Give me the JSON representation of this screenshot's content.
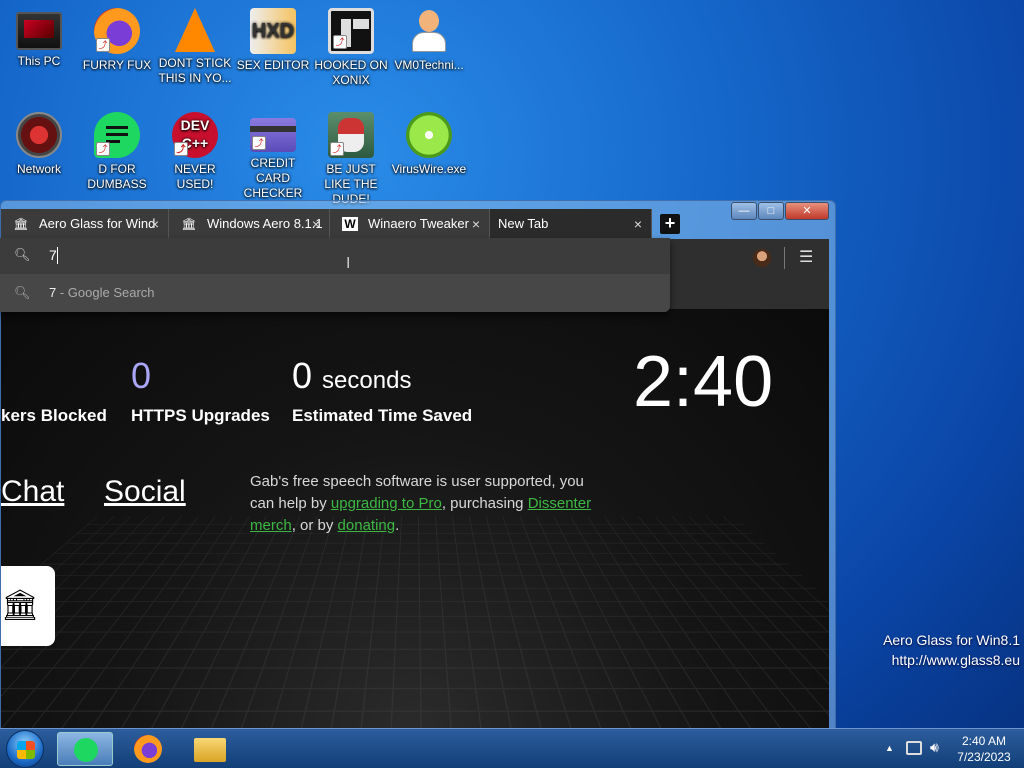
{
  "desktop": {
    "icons": [
      {
        "label": "This PC",
        "icon": "computer-icon"
      },
      {
        "label": "FURRY FUX",
        "icon": "firefox-icon"
      },
      {
        "label": "DONT STICK THIS IN YO...",
        "icon": "vlc-icon"
      },
      {
        "label": "SEX EDITOR",
        "icon": "hex-editor-icon"
      },
      {
        "label": "HOOKED ON XONIX",
        "icon": "xonix-icon"
      },
      {
        "label": "VM0Techni...",
        "icon": "doctor-icon"
      },
      {
        "label": "Network",
        "icon": "network-icon"
      },
      {
        "label": "D FOR DUMBASS",
        "icon": "dumbass-icon"
      },
      {
        "label": "NEVER USED!",
        "icon": "devcpp-icon"
      },
      {
        "label": "CREDIT CARD CHECKER",
        "icon": "credit-card-icon"
      },
      {
        "label": "BE JUST LIKE THE DUDE!",
        "icon": "dude-icon"
      },
      {
        "label": "VirusWire.exe",
        "icon": "limewire-icon"
      }
    ],
    "watermark": {
      "line1": "Aero Glass for Win8.1",
      "line2": "http://www.glass8.eu"
    }
  },
  "browser": {
    "tabs": [
      {
        "label": "Aero Glass for Wind",
        "icon": "institution-icon"
      },
      {
        "label": "Windows Aero 8.1.1",
        "icon": "institution-icon"
      },
      {
        "label": "Winaero Tweaker",
        "icon": "winaero-icon",
        "icon_glyph": "W"
      },
      {
        "label": "New Tab",
        "icon": ""
      }
    ],
    "tab_close": "×",
    "new_tab": "+",
    "window_controls": {
      "minimize": "—",
      "maximize": "□",
      "close": "✕"
    },
    "omnibox": {
      "value": "7",
      "suggestion_query": "7",
      "suggestion_suffix": " - Google Search"
    },
    "menu_glyph": "☰",
    "newtab": {
      "trackers_label": "kers Blocked",
      "https_value": "0",
      "https_label": "HTTPS Upgrades",
      "time_value": "0",
      "time_unit": "seconds",
      "time_label": "Estimated Time Saved",
      "clock": "2:40",
      "nav_chat": "Chat",
      "nav_social": "Social",
      "message": {
        "p1": "Gab's free speech software is user supported, you can help by ",
        "link1": "upgrading to Pro",
        "p2": ", purchasing ",
        "link2": "Dissenter merch",
        "p3": ", or by ",
        "link3": "donating",
        "p4": "."
      }
    }
  },
  "taskbar": {
    "time": "2:40 AM",
    "date": "7/23/2023",
    "tray_up": "▲"
  },
  "colors": {
    "accent_green": "#3db843",
    "https_purple": "#a9a7f5"
  }
}
